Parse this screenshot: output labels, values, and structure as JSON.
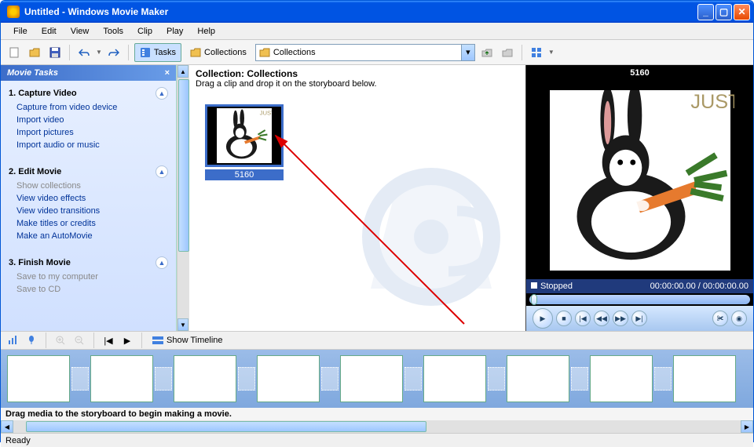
{
  "window": {
    "title": "Untitled - Windows Movie Maker"
  },
  "menubar": [
    "File",
    "Edit",
    "View",
    "Tools",
    "Clip",
    "Play",
    "Help"
  ],
  "toolbar": {
    "tasks": "Tasks",
    "collections": "Collections",
    "dropdown_value": "Collections"
  },
  "tasks_panel": {
    "header": "Movie Tasks",
    "sections": [
      {
        "title": "1. Capture Video",
        "links": [
          {
            "label": "Capture from video device",
            "enabled": true
          },
          {
            "label": "Import video",
            "enabled": true
          },
          {
            "label": "Import pictures",
            "enabled": true
          },
          {
            "label": "Import audio or music",
            "enabled": true
          }
        ]
      },
      {
        "title": "2. Edit Movie",
        "links": [
          {
            "label": "Show collections",
            "enabled": false
          },
          {
            "label": "View video effects",
            "enabled": true
          },
          {
            "label": "View video transitions",
            "enabled": true
          },
          {
            "label": "Make titles or credits",
            "enabled": true
          },
          {
            "label": "Make an AutoMovie",
            "enabled": true
          }
        ]
      },
      {
        "title": "3. Finish Movie",
        "links": [
          {
            "label": "Save to my computer",
            "enabled": false
          },
          {
            "label": "Save to CD",
            "enabled": false
          }
        ]
      }
    ]
  },
  "collection": {
    "header": "Collection: Collections",
    "hint": "Drag a clip and drop it on the storyboard below.",
    "clip_label": "5160",
    "clip_caption": "JUST TO SAY"
  },
  "preview": {
    "title": "5160",
    "status": "Stopped",
    "time": "00:00:00.00 / 00:00:00.00"
  },
  "timeline_toolbar": {
    "show_timeline": "Show Timeline"
  },
  "storyboard_hint": "Drag media to the storyboard to begin making a movie.",
  "statusbar": "Ready"
}
